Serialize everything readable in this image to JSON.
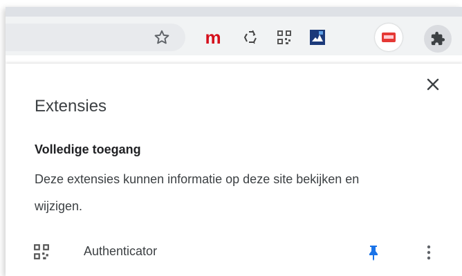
{
  "toolbar": {
    "icons": {
      "bookmark_star": "star-outline-icon",
      "m_extension_label": "m",
      "recycle_extension": "recycle-icon",
      "qr_extension": "qr-code-icon",
      "puzzle_extension": "puzzle-image-icon",
      "pdf_extension": "pdf-badge-icon",
      "extensions_button": "puzzle-piece-icon"
    }
  },
  "popup": {
    "title": "Extensies",
    "section_title": "Volledige toegang",
    "description": "Deze extensies kunnen informatie op deze site bekijken en wijzigen.",
    "close_icon": "close-icon",
    "extensions": [
      {
        "name": "Authenticator",
        "icon": "qr-code-icon",
        "pinned": true,
        "pin_icon": "pin-icon",
        "more_icon": "more-vert-icon"
      }
    ]
  },
  "colors": {
    "toolbar_bg": "#f1f3f4",
    "m_red": "#d50f1b",
    "pin_blue": "#1a73e8",
    "text": "#3c4043"
  }
}
